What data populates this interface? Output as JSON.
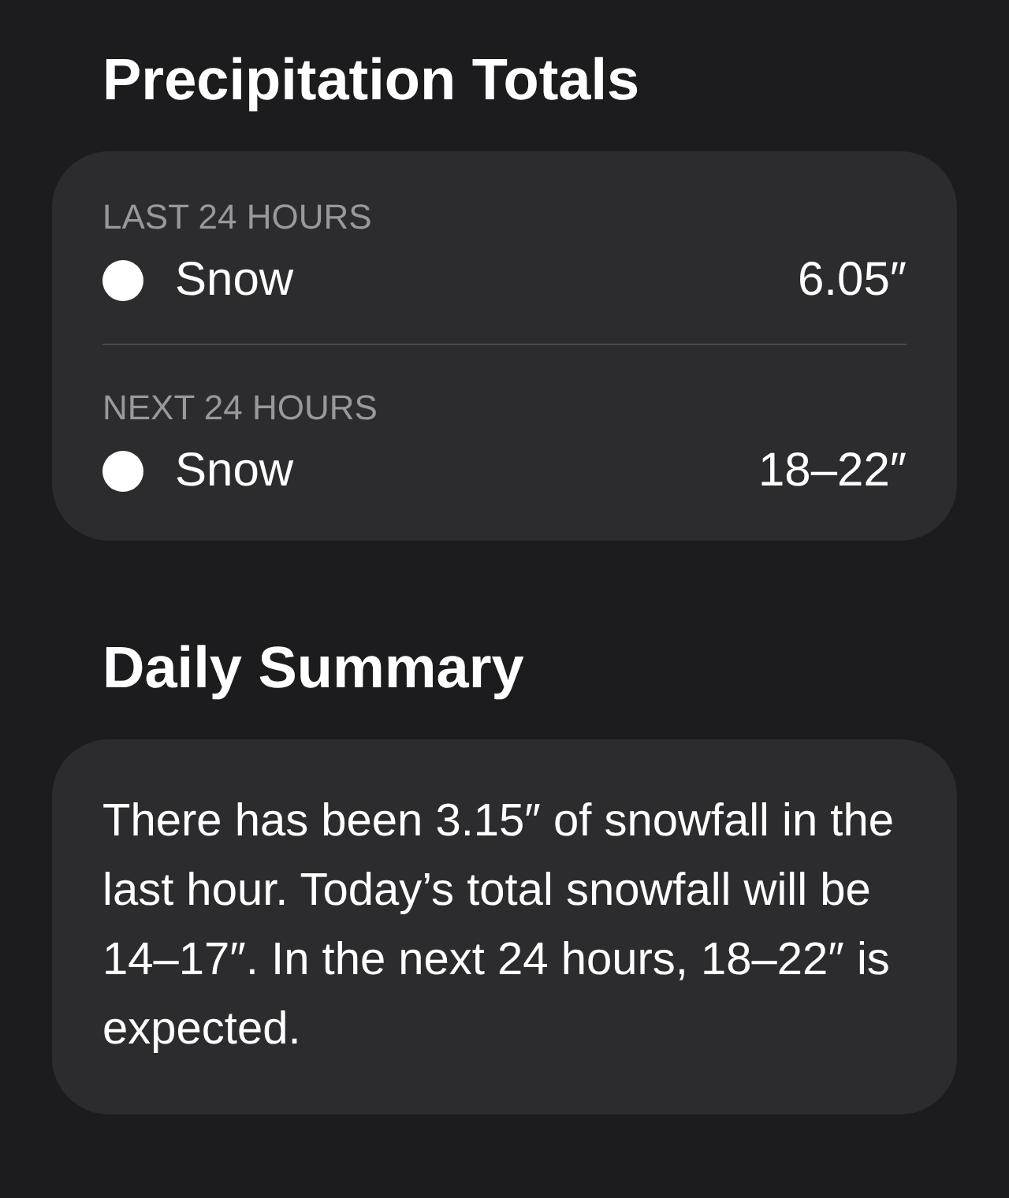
{
  "precipitation": {
    "title": "Precipitation Totals",
    "periods": [
      {
        "label": "LAST 24 HOURS",
        "type": "Snow",
        "color": "#ffffff",
        "amount": "6.05″"
      },
      {
        "label": "NEXT 24 HOURS",
        "type": "Snow",
        "color": "#ffffff",
        "amount": "18–22″"
      }
    ]
  },
  "summary": {
    "title": "Daily Summary",
    "text": "There has been 3.15″ of snowfall in the last hour. Today’s total snowfall will be 14–17″. In the next 24 hours, 18–22″ is expected."
  }
}
